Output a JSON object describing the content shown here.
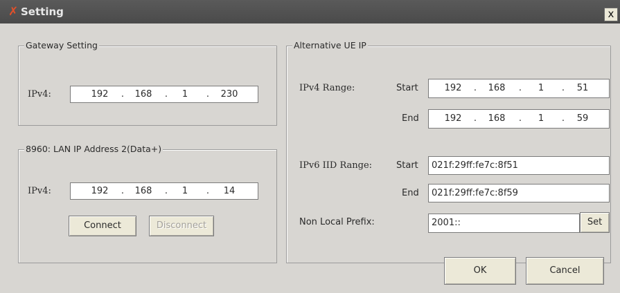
{
  "window": {
    "title": "Setting",
    "close_glyph": "x",
    "icon": "app-icon"
  },
  "gateway": {
    "legend": "Gateway Setting",
    "ipv4_label": "IPv4:",
    "ip": [
      "192",
      "168",
      "1",
      "230"
    ]
  },
  "lan": {
    "legend": "8960: LAN IP Address 2(Data+)",
    "ipv4_label": "IPv4:",
    "ip": [
      "192",
      "168",
      "1",
      "14"
    ],
    "connect_label": "Connect",
    "disconnect_label": "Disconnect"
  },
  "alt": {
    "legend": "Alternative UE IP",
    "ipv4_range_label": "IPv4 Range:",
    "start_label": "Start",
    "end_label": "End",
    "ipv4_start": [
      "192",
      "168",
      "1",
      "51"
    ],
    "ipv4_end": [
      "192",
      "168",
      "1",
      "59"
    ],
    "ipv6_range_label": "IPv6 IID Range:",
    "ipv6_start": "021f:29ff:fe7c:8f51",
    "ipv6_end": "021f:29ff:fe7c:8f59",
    "prefix_label": "Non Local Prefix:",
    "prefix_value": "2001::",
    "set_label": "Set"
  },
  "dialog": {
    "ok_label": "OK",
    "cancel_label": "Cancel"
  },
  "colors": {
    "titlebar": "#4f4f4f",
    "title_icon": "#e3502a",
    "client": "#d8d6d2"
  }
}
